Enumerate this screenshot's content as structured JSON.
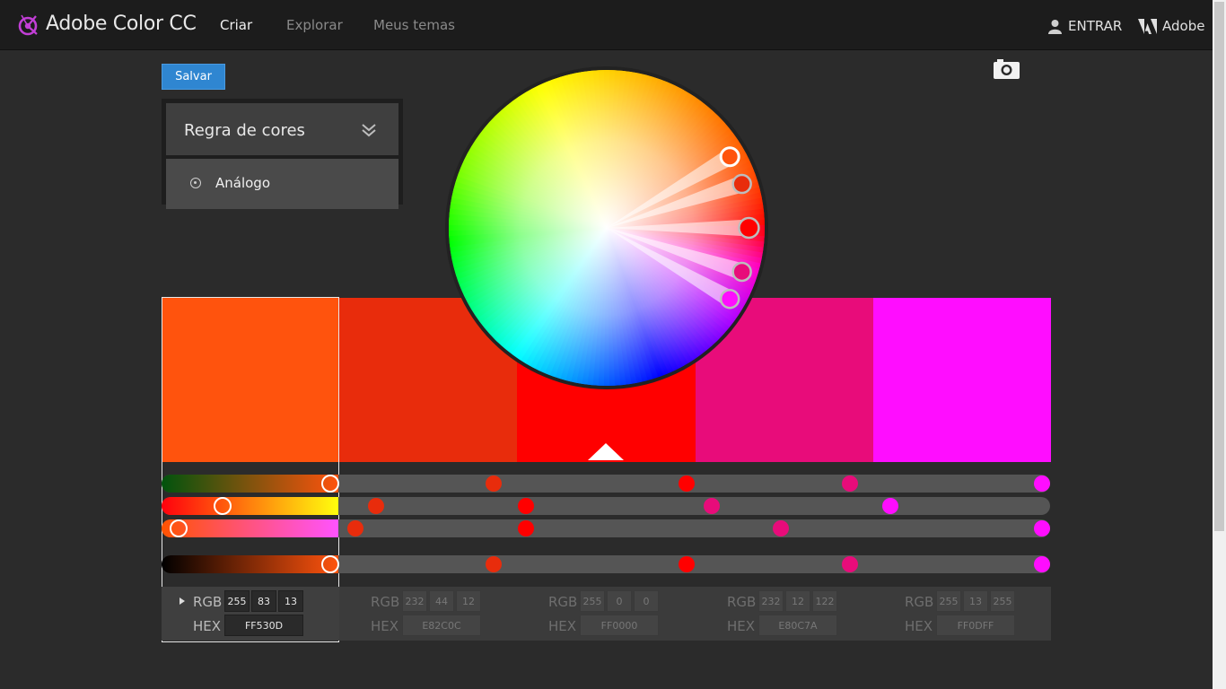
{
  "header": {
    "app_title": "Adobe Color CC",
    "tabs": [
      {
        "label": "Criar",
        "active": true
      },
      {
        "label": "Explorar",
        "active": false
      },
      {
        "label": "Meus temas",
        "active": false
      }
    ],
    "signin_label": "ENTRAR",
    "brand_label": "Adobe"
  },
  "toolbar": {
    "save_label": "Salvar"
  },
  "rule_panel": {
    "title": "Regra de cores",
    "selected_option": "Análogo"
  },
  "theme": {
    "active_index": 0,
    "base_index": 2,
    "swatches": [
      {
        "hex": "FF530D",
        "rgb": [
          255,
          83,
          13
        ]
      },
      {
        "hex": "E82C0C",
        "rgb": [
          232,
          44,
          12
        ]
      },
      {
        "hex": "FF0000",
        "rgb": [
          255,
          0,
          0
        ]
      },
      {
        "hex": "E80C7A",
        "rgb": [
          232,
          12,
          122
        ]
      },
      {
        "hex": "FF0DFF",
        "rgb": [
          255,
          13,
          255
        ]
      }
    ]
  },
  "labels": {
    "rgb": "RGB",
    "hex": "HEX"
  },
  "icons": {
    "logo": "adobe-color-logo-icon",
    "user": "user-icon",
    "adobe": "adobe-logo-icon",
    "chevron": "double-chevron-down-icon",
    "camera": "camera-icon",
    "expand": "expand-triangle-icon"
  },
  "colors": {
    "accent": "#2f86d1",
    "logo": "#c23fd6"
  }
}
